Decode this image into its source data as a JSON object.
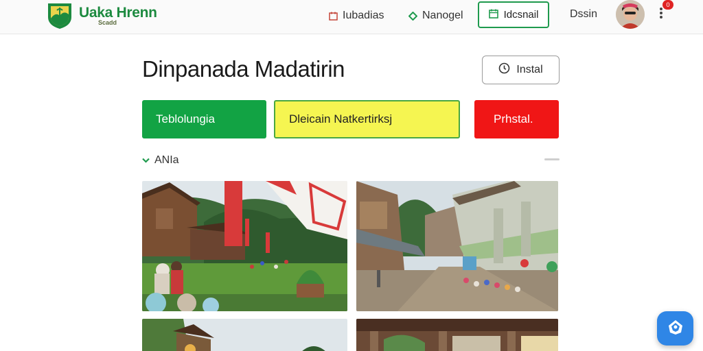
{
  "header": {
    "brand": "Uaka Hrenn",
    "brand_sub": "Scadd",
    "nav": [
      {
        "label": "Iubadias",
        "icon": "calendar-icon"
      },
      {
        "label": "Nanogel",
        "icon": "diamond-icon"
      },
      {
        "label": "Idcsnail",
        "icon": "calendar-icon",
        "active": true
      }
    ],
    "design_label": "Dssin",
    "notification_count": "0"
  },
  "main": {
    "title": "Dinpanada Madatirin",
    "install_label": "Instal",
    "actions": [
      {
        "label": "Teblolungia",
        "color": "#12a344"
      },
      {
        "label": "Dleicain Natkertirksj",
        "color": "#f5f551"
      },
      {
        "label": "Prhstal.",
        "color": "#f01616"
      }
    ],
    "filter_label": "ANIa"
  },
  "colors": {
    "brand_green": "#1c8a3f",
    "accent_blue": "#2f86e6"
  }
}
